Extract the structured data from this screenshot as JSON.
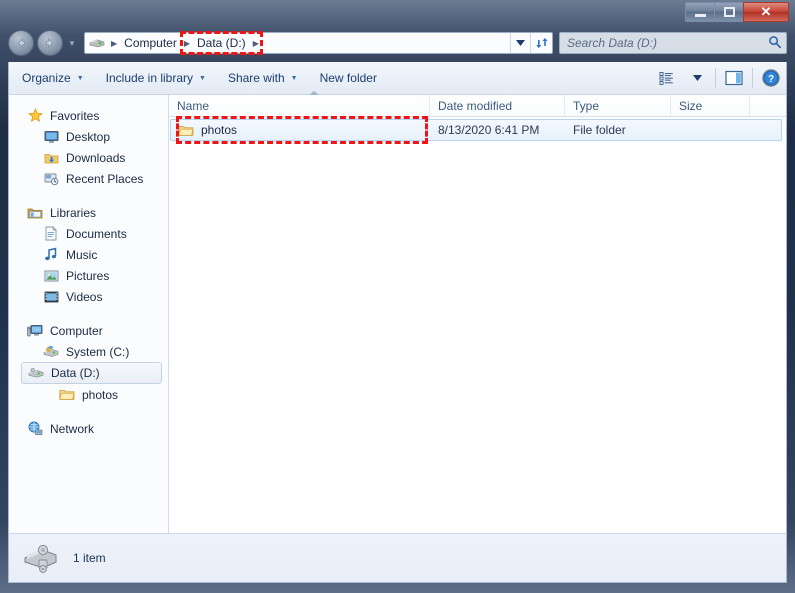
{
  "window": {
    "title": "",
    "controls": {
      "minimize": "Minimize",
      "maximize": "Maximize",
      "close": "Close",
      "close_glyph": "✕"
    }
  },
  "navigation": {
    "back_label": "Back",
    "back_glyph": "⬅",
    "forward_label": "Forward",
    "forward_glyph": "➡",
    "recent_pages_glyph": "▼",
    "dropdown_glyph": "▼",
    "refresh_glyph": "↻"
  },
  "address_bar": {
    "breadcrumbs": [
      {
        "label": "Computer",
        "separator": "▸"
      },
      {
        "label": "Data (D:)",
        "separator": "▸"
      }
    ],
    "drive_icon": "drive-icon"
  },
  "search": {
    "placeholder": "Search Data (D:)",
    "icon_glyph": "⌕"
  },
  "toolbar": {
    "items": [
      {
        "label": "Organize",
        "has_chevron": true,
        "chevron": "▼"
      },
      {
        "label": "Include in library",
        "has_chevron": true,
        "chevron": "▼"
      },
      {
        "label": "Share with",
        "has_chevron": true,
        "chevron": "▼"
      },
      {
        "label": "New folder",
        "has_chevron": false,
        "chevron": ""
      }
    ],
    "view_options_chevron": "▼",
    "view_options_label": "Change your view",
    "preview_pane_label": "Show the preview pane",
    "help_label": "Get help",
    "help_glyph": "?"
  },
  "sidebar": {
    "groups": [
      {
        "header": {
          "label": "Favorites",
          "icon": "star-icon"
        },
        "items": [
          {
            "label": "Desktop",
            "icon": "desktop-icon"
          },
          {
            "label": "Downloads",
            "icon": "downloads-icon"
          },
          {
            "label": "Recent Places",
            "icon": "recent-places-icon"
          }
        ]
      },
      {
        "header": {
          "label": "Libraries",
          "icon": "libraries-icon"
        },
        "items": [
          {
            "label": "Documents",
            "icon": "documents-icon"
          },
          {
            "label": "Music",
            "icon": "music-icon"
          },
          {
            "label": "Pictures",
            "icon": "pictures-icon"
          },
          {
            "label": "Videos",
            "icon": "videos-icon"
          }
        ]
      },
      {
        "header": {
          "label": "Computer",
          "icon": "computer-icon"
        },
        "items": [
          {
            "label": "System (C:)",
            "icon": "system-drive-icon",
            "selected": false
          },
          {
            "label": "Data (D:)",
            "icon": "data-drive-icon",
            "selected": true
          },
          {
            "label": "photos",
            "icon": "folder-icon",
            "selected": false,
            "nested": true
          }
        ]
      },
      {
        "header": {
          "label": "Network",
          "icon": "network-icon"
        },
        "items": []
      }
    ]
  },
  "file_list": {
    "columns": [
      {
        "key": "name",
        "label": "Name",
        "sorted": true
      },
      {
        "key": "date",
        "label": "Date modified",
        "sorted": false
      },
      {
        "key": "type",
        "label": "Type",
        "sorted": false
      },
      {
        "key": "size",
        "label": "Size",
        "sorted": false
      }
    ],
    "rows": [
      {
        "name": "photos",
        "date": "8/13/2020 6:41 PM",
        "type": "File folder",
        "size": "",
        "icon": "folder-icon",
        "selected": true
      }
    ]
  },
  "status_bar": {
    "item_count": "1 item",
    "icon": "drive-icon"
  },
  "annotations": [
    {
      "name": "breadcrumb-highlight",
      "target": "Data (D:)",
      "color": "#f11414",
      "style": "dashed"
    },
    {
      "name": "file-row-highlight",
      "target": "photos",
      "color": "#f11414",
      "style": "dashed"
    }
  ],
  "colors": {
    "annotation_red": "#f11414",
    "selection_blue": "#b6d3ef",
    "header_text": "#3b5a7f",
    "link_text": "#1c3f6e"
  }
}
